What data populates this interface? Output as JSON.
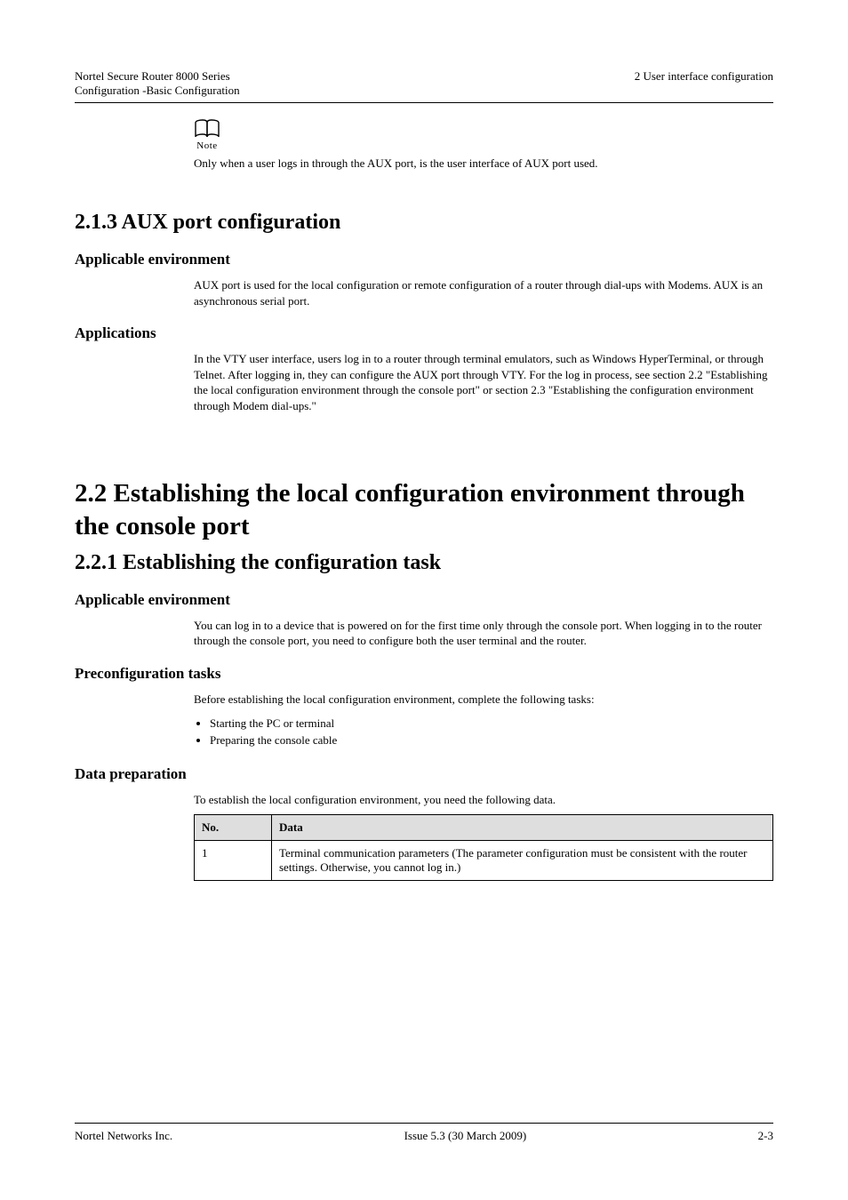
{
  "header": {
    "left_line1": "Nortel Secure Router 8000 Series",
    "left_line2": "Configuration -Basic Configuration",
    "right_line1": "",
    "right_line2": "2 User interface configuration"
  },
  "note": {
    "label": "Note",
    "text": "Only when a user logs in through the AUX port, is the user interface of AUX port used."
  },
  "s213": {
    "heading": "2.1.3 AUX port configuration",
    "env_heading": "Applicable environment",
    "env_text": "AUX port is used for the local configuration or remote configuration of a router through dial-ups with Modems. AUX is an asynchronous serial port.",
    "app_heading": "Applications",
    "app_text": "In the VTY user interface, users log in to a router through terminal emulators, such as Windows HyperTerminal, or through Telnet. After logging in, they can configure the AUX port through VTY. For the log in process, see section 2.2 \"Establishing the local configuration environment through the console port\" or section 2.3 \"Establishing the configuration environment through Modem dial-ups.\""
  },
  "s22": {
    "heading": "2.2 Establishing the local configuration environment through the console port"
  },
  "s221": {
    "heading": "2.2.1 Establishing the configuration task",
    "env_heading": "Applicable environment",
    "env_text": "You can log in to a device that is powered on for the first time only through the console port. When logging in to the router through the console port, you need to configure both the user terminal and the router.",
    "pre_heading": "Preconfiguration tasks",
    "pre_intro": "Before establishing the local configuration environment, complete the following tasks:",
    "pre_items": [
      "Starting the PC or terminal",
      "Preparing the console cable"
    ],
    "data_heading": "Data preparation",
    "data_intro": "To establish the local configuration environment, you need the following data.",
    "table": {
      "headers": {
        "no": "No.",
        "data": "Data"
      },
      "rows": [
        {
          "no": "1",
          "data": "Terminal communication parameters (The parameter configuration must be consistent with the router settings. Otherwise, you cannot log in.)"
        }
      ]
    }
  },
  "footer": {
    "left": "Nortel Networks Inc.",
    "center": "Issue 5.3 (30 March 2009)",
    "right": "2-3"
  }
}
